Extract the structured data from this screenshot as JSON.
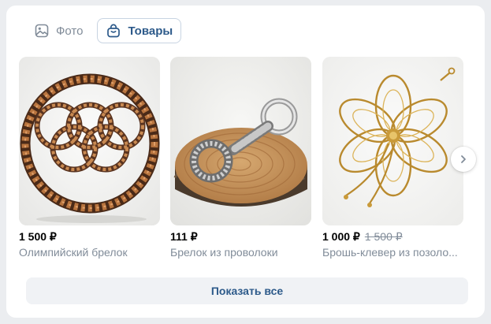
{
  "tabs": [
    {
      "label": "Фото",
      "icon": "image-icon",
      "active": false
    },
    {
      "label": "Товары",
      "icon": "shopping-bag-icon",
      "active": true
    }
  ],
  "products": [
    {
      "price": "1 500 ₽",
      "name": "Олимпийский брелок",
      "image": "olympic-rings-wire-keychain"
    },
    {
      "price": "111 ₽",
      "name": "Брелок из проволоки",
      "image": "wire-keychain-on-wood"
    },
    {
      "price": "1 000 ₽",
      "old_price": "1 500 ₽",
      "name": "Брошь-клевер из позоло...",
      "image": "gold-clover-brooch"
    }
  ],
  "next_button": {
    "icon": "chevron-right-icon"
  },
  "show_all": {
    "label": "Показать все"
  },
  "colors": {
    "accent": "#2d5a8a",
    "muted_text": "#818c99",
    "button_bg": "#f0f2f5",
    "page_bg": "#ebedf0"
  }
}
